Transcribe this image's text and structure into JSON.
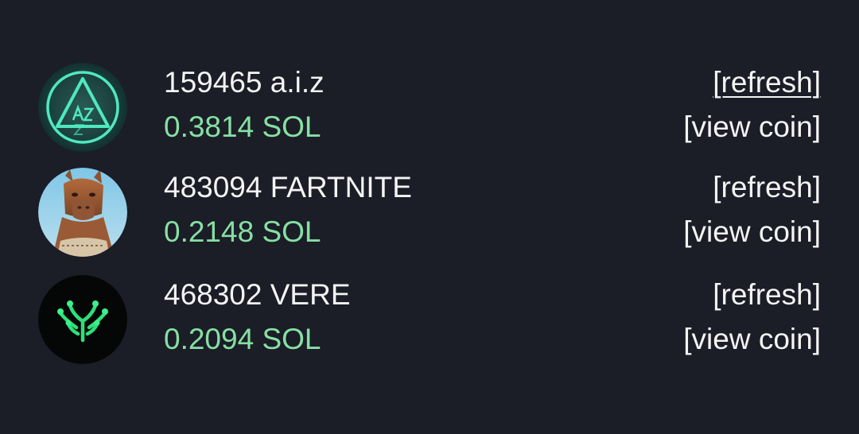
{
  "coins": [
    {
      "id": "159465",
      "name": "a.i.z",
      "amount": "0.3814 SOL",
      "refresh_label": "[refresh]",
      "view_label": "[view coin]",
      "avatar_icon": "aiz-triangle-logo"
    },
    {
      "id": "483094",
      "name": "FARTNITE",
      "amount": "0.2148 SOL",
      "refresh_label": "[refresh]",
      "view_label": "[view coin]",
      "avatar_icon": "llama-character-avatar"
    },
    {
      "id": "468302",
      "name": "VERE",
      "amount": "0.2094 SOL",
      "refresh_label": "[refresh]",
      "view_label": "[view coin]",
      "avatar_icon": "green-branch-logo"
    }
  ],
  "colors": {
    "background": "#1b1d27",
    "text": "#f4f4f4",
    "amount": "#86e0a3"
  }
}
